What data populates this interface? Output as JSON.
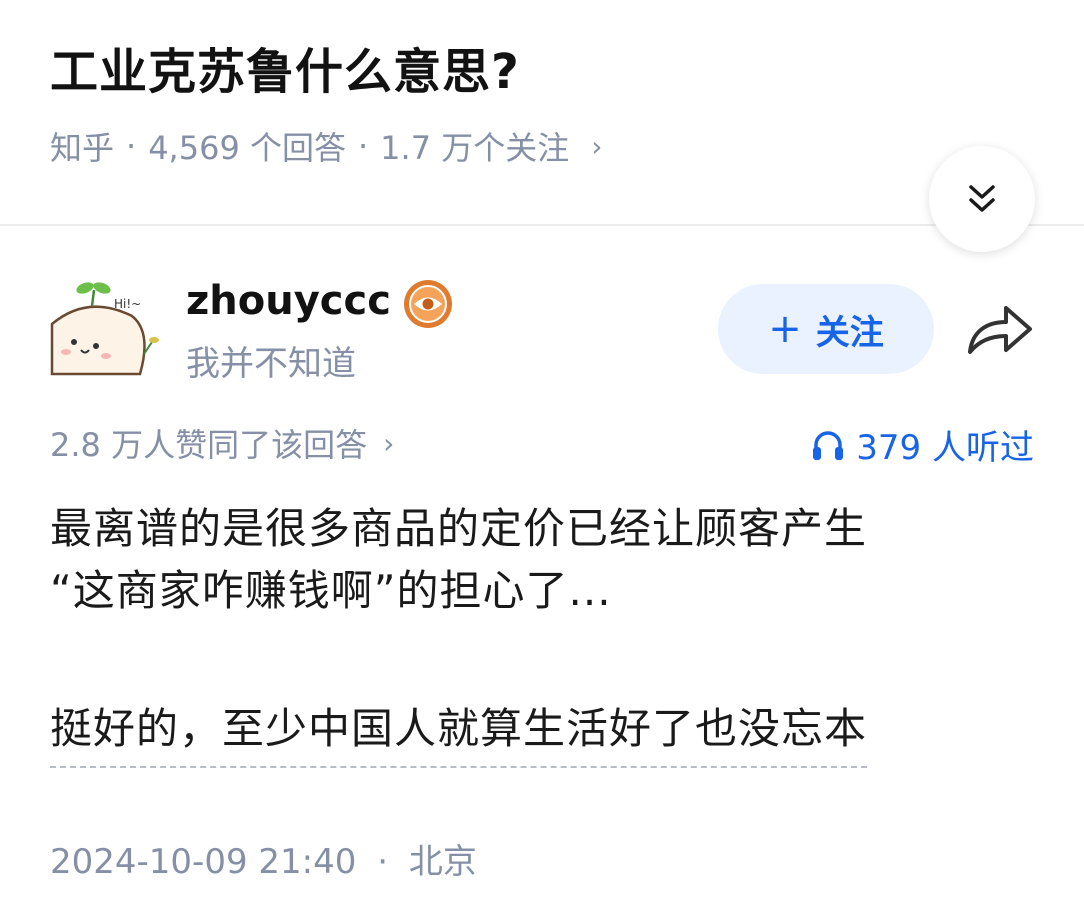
{
  "question": {
    "title": "工业克苏鲁什么意思?",
    "source": "知乎",
    "answers_count": "4,569 个回答",
    "followers_count": "1.7 万个关注"
  },
  "author": {
    "name": "zhouyccc",
    "bio": "我并不知道",
    "avatar_text": "Hi!~",
    "follow_label": "关注"
  },
  "stats": {
    "upvotes": "2.8 万人赞同了该回答",
    "listens": "379 人听过"
  },
  "answer": {
    "line1": "最离谱的是很多商品的定价已经让顾客产生",
    "line2": "“这商家咋赚钱啊”的担心了...",
    "line3": "挺好的，至少中国人就算生活好了也没忘本"
  },
  "footer": {
    "datetime": "2024-10-09 21:40",
    "location": "北京"
  },
  "icons": {
    "collapse": "double-chevron-down-icon",
    "share": "share-arrow-icon",
    "headphones": "headphones-icon",
    "badge": "eye-badge-icon"
  },
  "colors": {
    "accent": "#1764e8",
    "follow_bg": "#eaf2ff",
    "muted": "#8590a6",
    "badge": "#e07b2e"
  }
}
